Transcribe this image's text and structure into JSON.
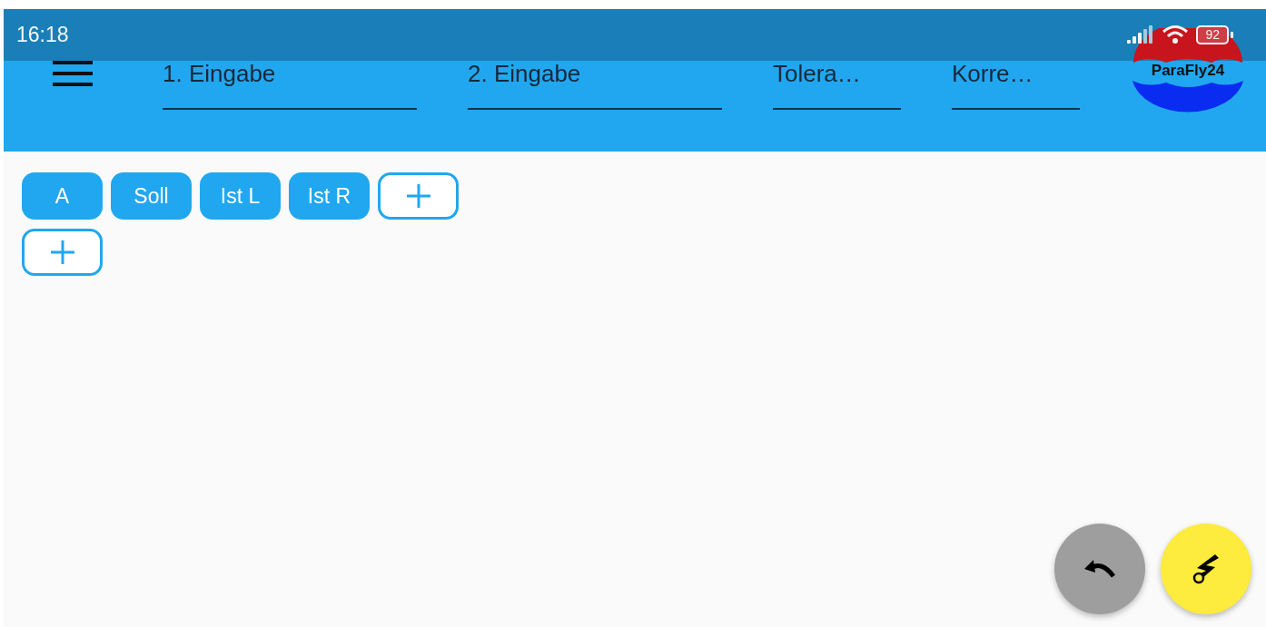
{
  "status_bar": {
    "time": "16:18",
    "battery": "92"
  },
  "app_bar": {
    "fields": [
      {
        "placeholder": "1. Eingabe",
        "kind": "wide"
      },
      {
        "placeholder": "2. Eingabe",
        "kind": "wide"
      },
      {
        "placeholder": "Tolera…",
        "kind": "narrow"
      },
      {
        "placeholder": "Korre…",
        "kind": "narrow"
      }
    ],
    "logo": "ParaFly24"
  },
  "chip_rows": [
    [
      {
        "kind": "filled",
        "label": "A"
      },
      {
        "kind": "filled",
        "label": "Soll"
      },
      {
        "kind": "filled",
        "label": "Ist L"
      },
      {
        "kind": "filled",
        "label": "Ist R"
      },
      {
        "kind": "add"
      }
    ],
    [
      {
        "kind": "add"
      }
    ]
  ],
  "fabs": [
    {
      "kind": "undo"
    },
    {
      "kind": "tool"
    }
  ]
}
